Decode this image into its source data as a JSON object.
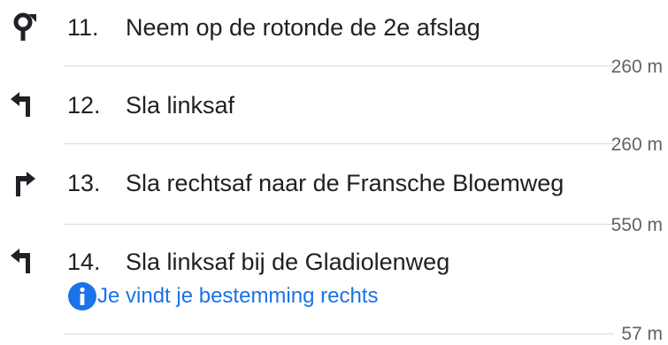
{
  "steps": [
    {
      "number": "11.",
      "instruction": "Neem op de rotonde de 2e afslag",
      "icon": "roundabout-icon",
      "distance": "260 m"
    },
    {
      "number": "12.",
      "instruction": "Sla linksaf",
      "icon": "turn-left-icon",
      "distance": "260 m"
    },
    {
      "number": "13.",
      "instruction": "Sla rechtsaf naar de Fransche Bloemweg",
      "icon": "turn-right-icon",
      "distance": "550 m"
    },
    {
      "number": "14.",
      "instruction": "Sla linksaf bij de Gladiolenweg",
      "icon": "turn-left-icon",
      "note": "Je vindt je bestemming rechts",
      "note_icon": "info-icon",
      "distance": "57 m"
    }
  ],
  "colors": {
    "text": "#202124",
    "note": "#1a73e8",
    "divider": "#dadce0",
    "distance": "#5f6368"
  }
}
